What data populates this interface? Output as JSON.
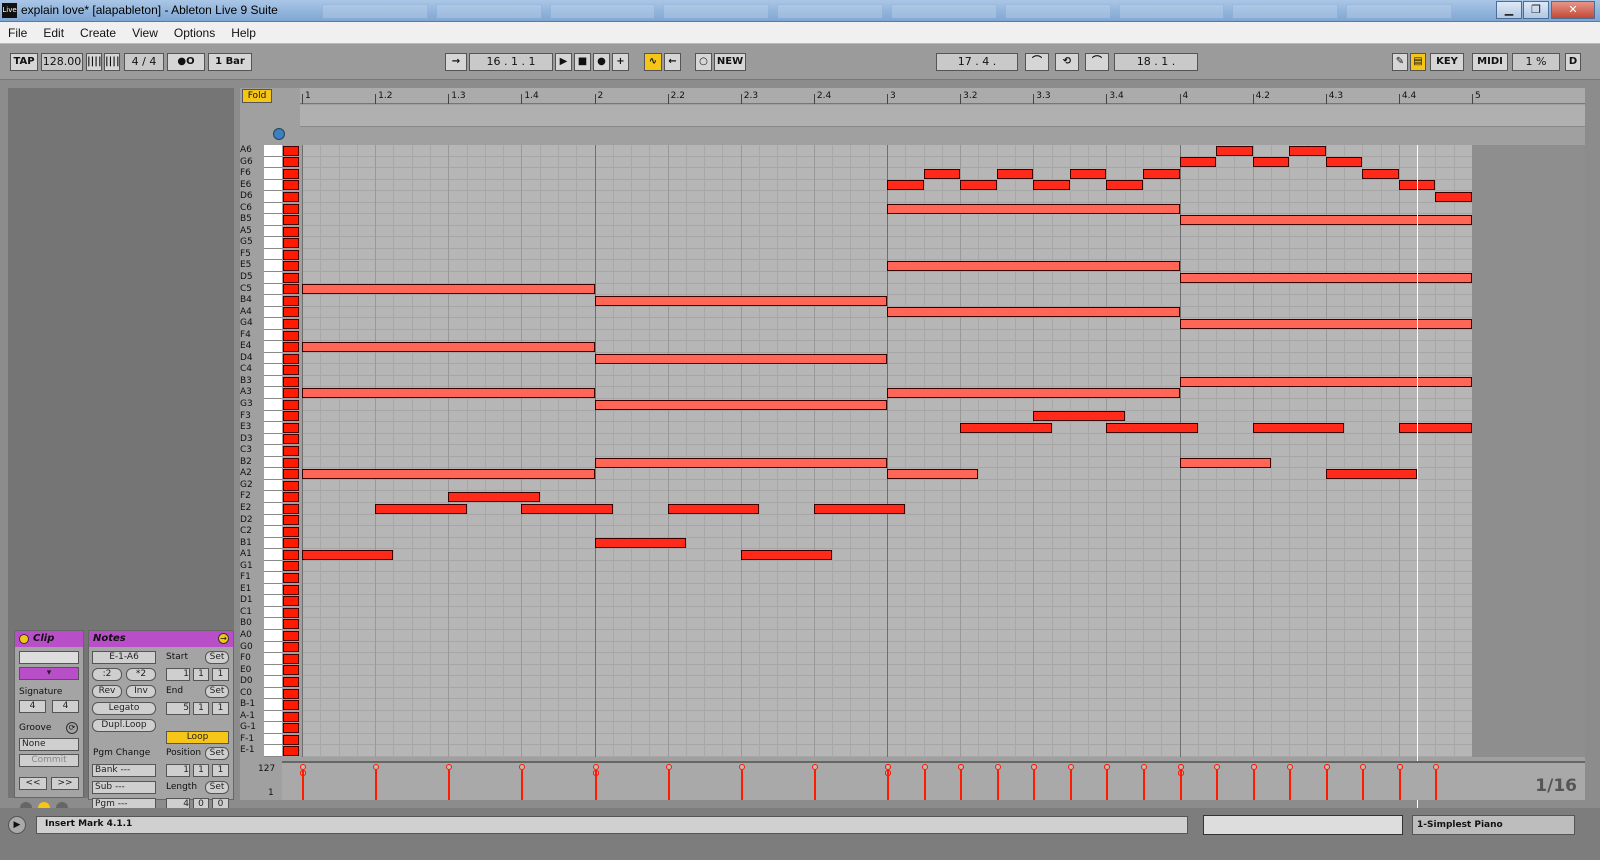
{
  "window": {
    "title": "explain love*  [alapableton] - Ableton Live 9 Suite",
    "app_icon": "Live",
    "controls": {
      "minimize": "▁",
      "maximize": "❐",
      "close": "✕"
    }
  },
  "menu": [
    "File",
    "Edit",
    "Create",
    "View",
    "Options",
    "Help"
  ],
  "transport": {
    "tap": "TAP",
    "tempo": "128.00",
    "nudge_down": "||||",
    "nudge_up": "||||",
    "signature": "4  /  4",
    "metronome": "●O",
    "quantization": "1 Bar",
    "position": "16 .   1 .   1",
    "loop_start": "17 .   4 .",
    "loop_end": "18 .   1 .",
    "new_label": "NEW",
    "key_label": "KEY",
    "midi_label": "MIDI",
    "cpu": "1 %",
    "d_label": "D"
  },
  "ruler_labels": [
    {
      "label": "1",
      "bar": 1
    },
    {
      "label": "1.2",
      "bar": 1.25
    },
    {
      "label": "1.3",
      "bar": 1.5
    },
    {
      "label": "1.4",
      "bar": 1.75
    },
    {
      "label": "2",
      "bar": 2
    },
    {
      "label": "2.2",
      "bar": 2.25
    },
    {
      "label": "2.3",
      "bar": 2.5
    },
    {
      "label": "2.4",
      "bar": 2.75
    },
    {
      "label": "3",
      "bar": 3
    },
    {
      "label": "3.2",
      "bar": 3.25
    },
    {
      "label": "3.3",
      "bar": 3.5
    },
    {
      "label": "3.4",
      "bar": 3.75
    },
    {
      "label": "4",
      "bar": 4
    },
    {
      "label": "4.2",
      "bar": 4.25
    },
    {
      "label": "4.3",
      "bar": 4.5
    },
    {
      "label": "4.4",
      "bar": 4.75
    },
    {
      "label": "5",
      "bar": 5
    }
  ],
  "fold_label": "Fold",
  "notes_rows": [
    "A6",
    "G6",
    "F6",
    "E6",
    "D6",
    "C6",
    "B5",
    "A5",
    "G5",
    "F5",
    "E5",
    "D5",
    "C5",
    "B4",
    "A4",
    "G4",
    "F4",
    "E4",
    "D4",
    "C4",
    "B3",
    "A3",
    "G3",
    "F3",
    "E3",
    "D3",
    "C3",
    "B2",
    "A2",
    "G2",
    "F2",
    "E2",
    "D2",
    "C2",
    "B1",
    "A1",
    "G1",
    "F1",
    "E1",
    "D1",
    "C1",
    "B0",
    "A0",
    "G0",
    "F0",
    "E0",
    "D0",
    "C0",
    "B-1",
    "A-1",
    "G-1",
    "F-1",
    "E-1"
  ],
  "midi_notes": [
    {
      "pitch": "C5",
      "start": 0,
      "len": 4,
      "sel": true
    },
    {
      "pitch": "E4",
      "start": 0,
      "len": 4,
      "sel": true
    },
    {
      "pitch": "A3",
      "start": 0,
      "len": 4,
      "sel": true
    },
    {
      "pitch": "A2",
      "start": 0,
      "len": 4,
      "sel": true
    },
    {
      "pitch": "A1",
      "start": 0,
      "len": 1.25
    },
    {
      "pitch": "E2",
      "start": 1,
      "len": 1.25
    },
    {
      "pitch": "F2",
      "start": 2,
      "len": 1.25
    },
    {
      "pitch": "E2",
      "start": 3,
      "len": 1.25
    },
    {
      "pitch": "B4",
      "start": 4,
      "len": 4,
      "sel": true
    },
    {
      "pitch": "D4",
      "start": 4,
      "len": 4,
      "sel": true
    },
    {
      "pitch": "G3",
      "start": 4,
      "len": 4,
      "sel": true
    },
    {
      "pitch": "B2",
      "start": 4,
      "len": 4,
      "sel": true
    },
    {
      "pitch": "B1",
      "start": 4,
      "len": 1.25
    },
    {
      "pitch": "E2",
      "start": 5,
      "len": 1.25
    },
    {
      "pitch": "A1",
      "start": 6,
      "len": 1.25
    },
    {
      "pitch": "E2",
      "start": 7,
      "len": 1.25
    },
    {
      "pitch": "C6",
      "start": 8,
      "len": 4,
      "sel": true
    },
    {
      "pitch": "E5",
      "start": 8,
      "len": 4,
      "sel": true
    },
    {
      "pitch": "A4",
      "start": 8,
      "len": 4,
      "sel": true
    },
    {
      "pitch": "A3",
      "start": 8,
      "len": 4,
      "sel": true
    },
    {
      "pitch": "A2",
      "start": 8,
      "len": 1.25,
      "sel": true
    },
    {
      "pitch": "E6",
      "start": 8,
      "len": 0.5
    },
    {
      "pitch": "F6",
      "start": 8.5,
      "len": 0.5
    },
    {
      "pitch": "E6",
      "start": 9,
      "len": 0.5
    },
    {
      "pitch": "F6",
      "start": 9.5,
      "len": 0.5
    },
    {
      "pitch": "E6",
      "start": 10,
      "len": 0.5
    },
    {
      "pitch": "F6",
      "start": 10.5,
      "len": 0.5
    },
    {
      "pitch": "E6",
      "start": 11,
      "len": 0.5
    },
    {
      "pitch": "F6",
      "start": 11.5,
      "len": 0.5
    },
    {
      "pitch": "E3",
      "start": 9,
      "len": 1.25
    },
    {
      "pitch": "F3",
      "start": 10,
      "len": 1.25
    },
    {
      "pitch": "E3",
      "start": 11,
      "len": 1.25
    },
    {
      "pitch": "B5",
      "start": 12,
      "len": 4,
      "sel": true
    },
    {
      "pitch": "D5",
      "start": 12,
      "len": 4,
      "sel": true
    },
    {
      "pitch": "G4",
      "start": 12,
      "len": 4,
      "sel": true
    },
    {
      "pitch": "B3",
      "start": 12,
      "len": 4,
      "sel": true
    },
    {
      "pitch": "B2",
      "start": 12,
      "len": 1.25,
      "sel": true
    },
    {
      "pitch": "G6",
      "start": 12,
      "len": 0.5
    },
    {
      "pitch": "A6",
      "start": 12.5,
      "len": 0.5
    },
    {
      "pitch": "G6",
      "start": 13,
      "len": 0.5
    },
    {
      "pitch": "A6",
      "start": 13.5,
      "len": 0.5
    },
    {
      "pitch": "G6",
      "start": 14,
      "len": 0.5
    },
    {
      "pitch": "F6",
      "start": 14.5,
      "len": 0.5
    },
    {
      "pitch": "E6",
      "start": 15,
      "len": 0.5
    },
    {
      "pitch": "D6",
      "start": 15.5,
      "len": 0.5
    },
    {
      "pitch": "E3",
      "start": 13,
      "len": 1.25
    },
    {
      "pitch": "A2",
      "start": 14,
      "len": 1.25
    },
    {
      "pitch": "E3",
      "start": 15,
      "len": 1
    }
  ],
  "velocity": {
    "max_label": "127",
    "min_label": "1"
  },
  "quantize_label": "1/16",
  "clip_panel": {
    "title": "Clip",
    "signature_label": "Signature",
    "sig_num": "4",
    "sig_den": "4",
    "groove_label": "Groove",
    "groove_value": "None",
    "commit": "Commit",
    "prev": "<<",
    "next": ">>"
  },
  "notes_panel": {
    "title": "Notes",
    "range": "E-1-A6",
    "div2": ":2",
    "mul2": "*2",
    "rev": "Rev",
    "inv": "Inv",
    "legato": "Legato",
    "dupl_loop": "Dupl.Loop",
    "pgm_change": "Pgm Change",
    "bank": "Bank ---",
    "sub": "Sub ---",
    "pgm": "Pgm ---",
    "start_label": "Start",
    "end_label": "End",
    "set": "Set",
    "loop_label": "Loop",
    "position_label": "Position",
    "length_label": "Length",
    "start_vals": [
      "1",
      "1",
      "1"
    ],
    "end_vals": [
      "5",
      "1",
      "1"
    ],
    "position_vals": [
      "1",
      "1",
      "1"
    ],
    "length_vals": [
      "4",
      "0",
      "0"
    ]
  },
  "status": {
    "text": "Insert Mark 4.1.1",
    "device": "1-Simplest Piano"
  },
  "colors": {
    "note": "#ff2a1a",
    "accent": "#f5c518",
    "panel_header": "#b84fc8"
  }
}
